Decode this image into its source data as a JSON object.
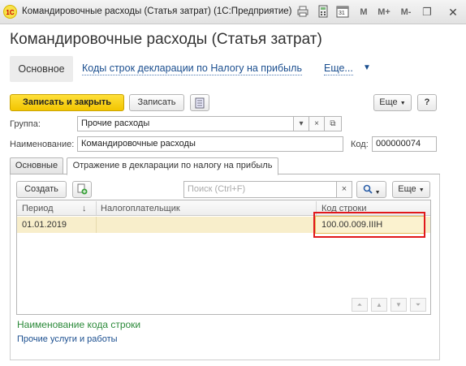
{
  "window": {
    "logo": "1С",
    "title": "Командировочные расходы (Статья затрат)  (1С:Предприятие)",
    "toolbar_icons": [
      "printer-icon",
      "calculator-icon",
      "calendar-icon"
    ],
    "calendar_day": "31",
    "m_buttons": [
      "M",
      "M+",
      "M-"
    ],
    "restore": "❐",
    "close": "✕"
  },
  "header": {
    "title": "Командировочные расходы (Статья затрат)"
  },
  "nav": {
    "main": "Основное",
    "declaration_codes": "Коды строк декларации по Налогу на прибыль",
    "more": "Еще...",
    "more_arrow": "▼"
  },
  "toolbar": {
    "save_close": "Записать и закрыть",
    "save": "Записать",
    "more": "Еще",
    "help": "?"
  },
  "form": {
    "group_label": "Группа:",
    "group_value": "Прочие расходы",
    "name_label": "Наименование:",
    "name_value": "Командировочные расходы",
    "code_label": "Код:",
    "code_value": "000000074"
  },
  "tabs": [
    {
      "label": "Основные",
      "active": false
    },
    {
      "label": "Отражение в декларации по налогу на прибыль",
      "active": true
    }
  ],
  "table_toolbar": {
    "create": "Создать",
    "search_placeholder": "Поиск (Ctrl+F)",
    "more": "Еще"
  },
  "table": {
    "columns": [
      "Период",
      "Налогоплательщик",
      "Код строки"
    ],
    "sort_indicator": "↓",
    "rows": [
      {
        "period": "01.01.2019",
        "taxpayer": "",
        "code": "100.00.009.IIIН"
      }
    ]
  },
  "description": {
    "title": "Наименование кода строки",
    "text": "Прочие услуги и работы"
  },
  "colors": {
    "accent_yellow": "#f5cc00",
    "link_blue": "#1a4e8f",
    "green_title": "#2c8a3a",
    "highlight_red": "#e1181b",
    "selected_row": "#f8eecb"
  }
}
